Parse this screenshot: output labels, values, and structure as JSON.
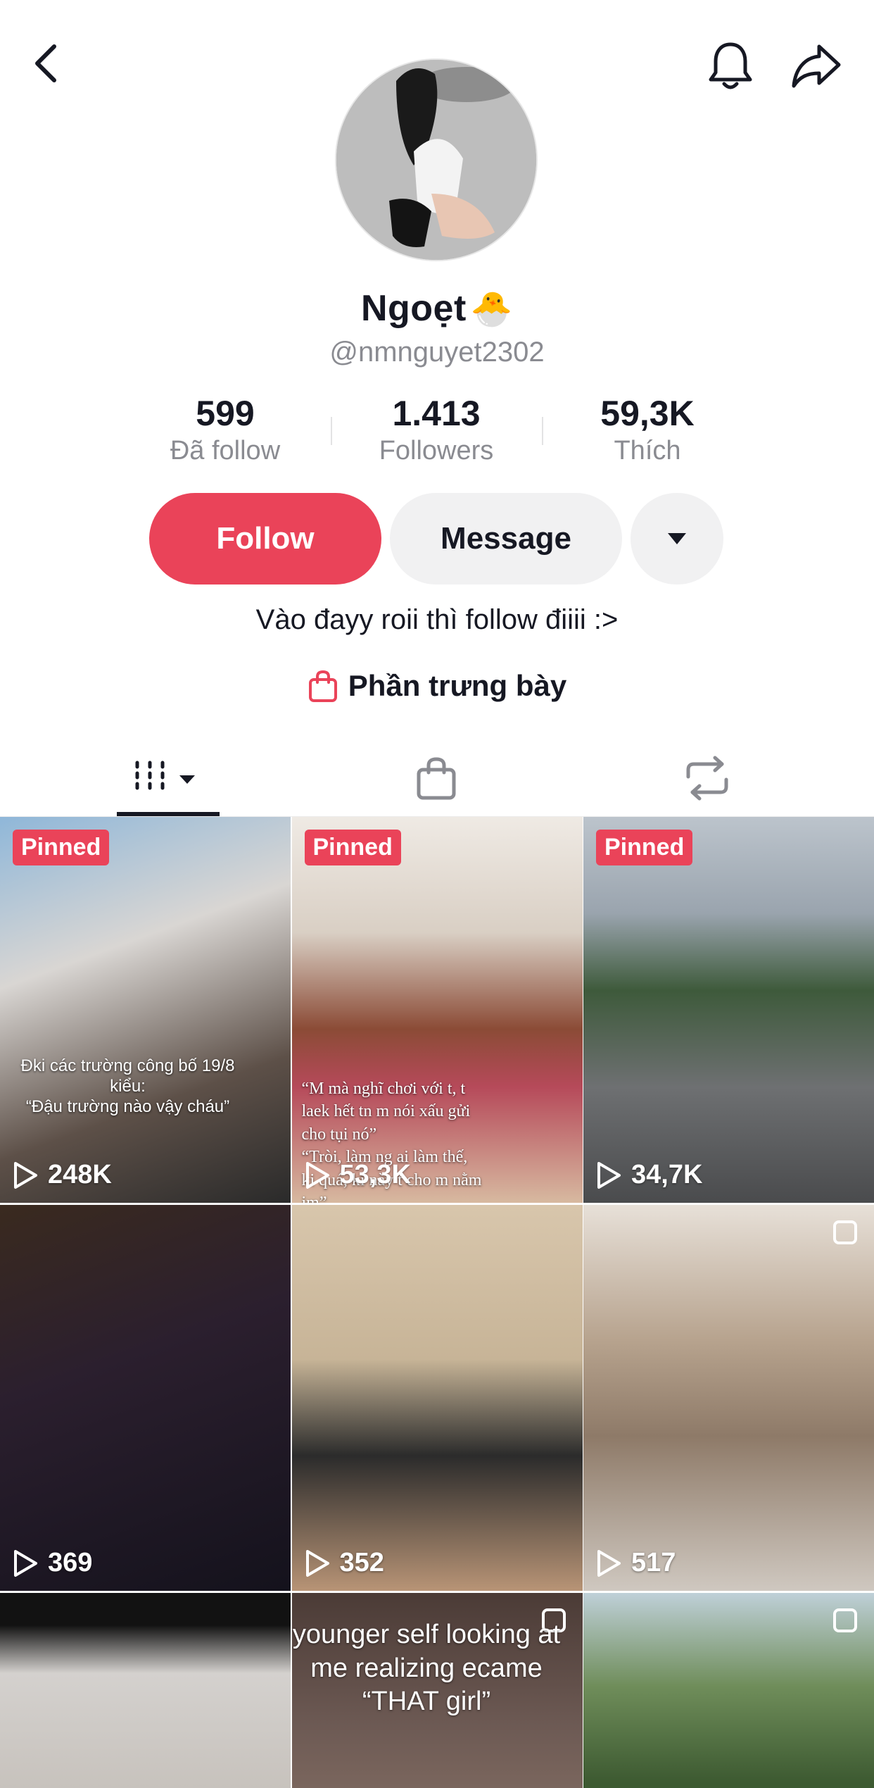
{
  "profile": {
    "name": "Ngoẹt",
    "name_emoji": "🐣",
    "handle": "@nmnguyet2302",
    "bio": "Vào đayy roii thì follow điiii :>",
    "showcase_label": "Phần trưng bày"
  },
  "stats": [
    {
      "value": "599",
      "label": "Đã follow"
    },
    {
      "value": "1.413",
      "label": "Followers"
    },
    {
      "value": "59,3K",
      "label": "Thích"
    }
  ],
  "actions": {
    "follow_label": "Follow",
    "message_label": "Message"
  },
  "tabs": [
    "videos-grid-icon",
    "shop-bag-icon",
    "repost-icon"
  ],
  "videos": [
    {
      "pinned": "Pinned",
      "views": "248K",
      "caption": "Đki các trường công bố 19/8 kiểu:\n“Đậu trường nào vậy cháu”"
    },
    {
      "pinned": "Pinned",
      "views": "53,3K",
      "caption": "“M mà nghĩ chơi với t, t laek hết tn m nói xấu gửi cho tụi nó”\n“Tròi, làm ng ai làm thế, ki quá, ki này t cho m nằm im”"
    },
    {
      "pinned": "Pinned",
      "views": "34,7K"
    },
    {
      "views": "369"
    },
    {
      "views": "352"
    },
    {
      "views": "517"
    },
    {},
    {
      "caption": "younger self looking at me realizing ecame “THAT girl”"
    },
    {}
  ],
  "colors": {
    "accent": "#ea4359",
    "text_primary": "#161823",
    "text_secondary": "#8a8b91",
    "button_secondary_bg": "#f1f1f2"
  }
}
